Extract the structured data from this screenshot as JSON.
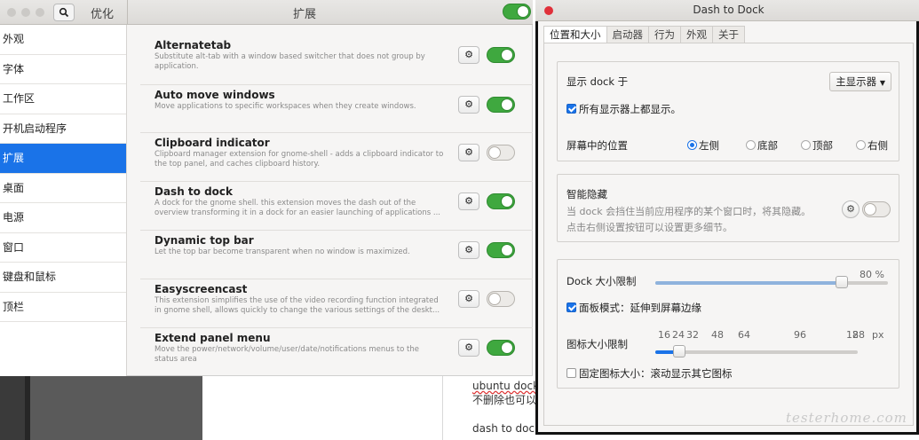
{
  "background_doc": {
    "line1": "ubuntu dock 是",
    "line2": "不删除也可以，",
    "line3": "dash to dock 这"
  },
  "tweaks": {
    "search_icon": "search-icon",
    "left_title": "优化",
    "title": "扩展",
    "global_switch_on": true,
    "sidebar": {
      "items": [
        {
          "label": "外观"
        },
        {
          "label": "字体"
        },
        {
          "label": "工作区"
        },
        {
          "label": "开机启动程序"
        },
        {
          "label": "扩展"
        },
        {
          "label": "桌面"
        },
        {
          "label": "电源"
        },
        {
          "label": "窗口"
        },
        {
          "label": "键盘和鼠标"
        },
        {
          "label": "顶栏"
        }
      ],
      "active_index": 4
    },
    "extensions": [
      {
        "name": "Alternatetab",
        "desc": "Substitute alt-tab with a window based switcher that does not group by application.",
        "enabled": true
      },
      {
        "name": "Auto move windows",
        "desc": "Move applications to specific workspaces when they create windows.",
        "enabled": true
      },
      {
        "name": "Clipboard indicator",
        "desc": "Clipboard manager extension for gnome-shell - adds a clipboard indicator to the top panel, and caches clipboard history.",
        "enabled": false
      },
      {
        "name": "Dash to dock",
        "desc": "A dock for the gnome shell. this extension moves the dash out of the overview transforming it in a dock for an easier launching of applications ...",
        "enabled": true
      },
      {
        "name": "Dynamic top bar",
        "desc": "Let the top bar become transparent when no window is maximized.",
        "enabled": true
      },
      {
        "name": "Easyscreencast",
        "desc": "This extension simplifies the use of the video recording function integrated in gnome shell, allows quickly to change the various settings of the deskt...",
        "enabled": false
      },
      {
        "name": "Extend panel menu",
        "desc": "Move the power/network/volume/user/date/notifications menus to the status area",
        "enabled": true
      }
    ]
  },
  "dash_to_dock": {
    "title": "Dash to Dock",
    "tabs": [
      {
        "label": "位置和大小"
      },
      {
        "label": "启动器"
      },
      {
        "label": "行为"
      },
      {
        "label": "外观"
      },
      {
        "label": "关于"
      }
    ],
    "active_tab": 0,
    "display": {
      "label": "显示 dock 于",
      "selected_monitor": "主显示器",
      "all_monitors_label": "所有显示器上都显示。",
      "all_monitors_checked": true
    },
    "position": {
      "label": "屏幕中的位置",
      "options": [
        {
          "label": "左侧",
          "selected": true
        },
        {
          "label": "底部",
          "selected": false
        },
        {
          "label": "顶部",
          "selected": false
        },
        {
          "label": "右侧",
          "selected": false
        }
      ]
    },
    "autohide": {
      "label": "智能隐藏",
      "hint1": "当 dock 会挡住当前应用程序的某个窗口时，将其隐藏。",
      "hint2": "点击右侧设置按钮可以设置更多细节。",
      "enabled": false
    },
    "dock_size": {
      "label": "Dock 大小限制",
      "value_label": "80 %",
      "fraction": 0.8
    },
    "panel_mode": {
      "label": "面板模式：延伸到屏幕边缘",
      "checked": true
    },
    "icon_size": {
      "label": "图标大小限制",
      "ticks": [
        "16",
        "24",
        "32",
        "48",
        "64",
        "96",
        "128"
      ],
      "tick_overlap_glyph": "8",
      "unit": "px",
      "fraction": 0.12
    },
    "fixed_icon": {
      "label": "固定图标大小：滚动显示其它图标",
      "checked": false
    }
  },
  "watermark": "testerhome.com",
  "colors": {
    "accent": "#1a73e8",
    "switch_on": "#3fa83f",
    "close_red": "#e0303a"
  }
}
